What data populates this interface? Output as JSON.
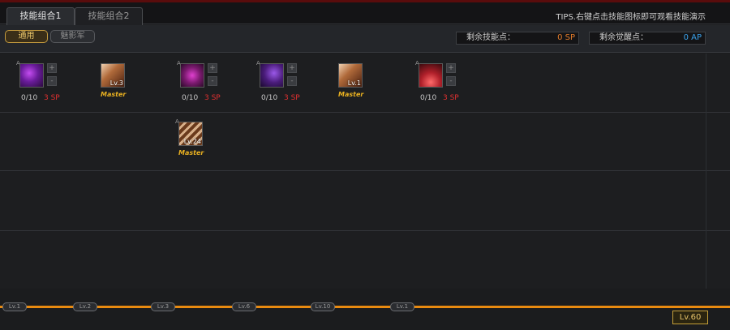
{
  "tabs": [
    {
      "label": "技能组合1",
      "active": true
    },
    {
      "label": "技能组合2",
      "active": false
    }
  ],
  "tips": "TIPS.右键点击技能图标即可观看技能演示",
  "filters": [
    {
      "label": "通用",
      "selected": true
    },
    {
      "label": "魅影军",
      "selected": false
    }
  ],
  "points": {
    "sp_label": "剩余技能点：",
    "sp_value": "0 SP",
    "ap_label": "剩余觉醒点：",
    "ap_value": "0 AP"
  },
  "skills": [
    {
      "icon": "purple-claw-skill-icon",
      "badge": "A",
      "counter": "0/10",
      "cost": "3 SP"
    },
    {
      "icon": "armored-warrior-skill-icon",
      "level": "Lv.3",
      "status": "Master"
    },
    {
      "icon": "magenta-slash-skill-icon",
      "badge": "A",
      "counter": "0/10",
      "cost": "3 SP"
    },
    {
      "icon": "violet-strike-skill-icon",
      "badge": "A",
      "counter": "0/10",
      "cost": "3 SP"
    },
    {
      "icon": "bronze-fist-skill-icon",
      "level": "Lv.1",
      "status": "Master"
    },
    {
      "icon": "crimson-burst-skill-icon",
      "badge": "A",
      "counter": "0/10",
      "cost": "3 SP"
    },
    {
      "icon": "brown-blade-skill-icon",
      "badge": "A",
      "level": "Lv.24",
      "status": "Master"
    }
  ],
  "level_markers": [
    "Lv.1",
    "Lv.2",
    "Lv.3",
    "Lv.6",
    "Lv.10",
    "Lv.1"
  ],
  "current_level": "Lv.60",
  "colors": {
    "accent": "#e88a10",
    "sp": "#e07a2a",
    "ap": "#3aa0e8",
    "master": "#e8b020",
    "cost": "#e03030"
  }
}
